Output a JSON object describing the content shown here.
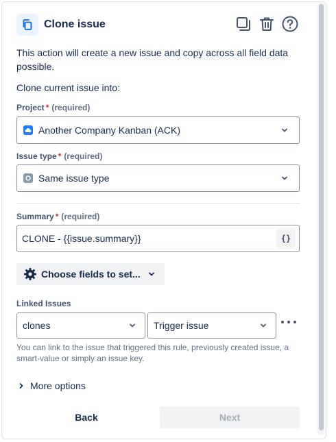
{
  "header": {
    "title": "Clone issue",
    "icon": "copy-icon",
    "actions": [
      "duplicate-icon",
      "delete-icon",
      "help-icon"
    ]
  },
  "description": "This action will create a new issue and copy across all field data possible.",
  "clone_into": "Clone current issue into:",
  "project": {
    "label": "Project",
    "required_marker": "*",
    "required_text": "(required)",
    "value": "Another Company Kanban (ACK)",
    "icon": "cloud-project-icon"
  },
  "issue_type": {
    "label": "Issue type",
    "required_marker": "*",
    "required_text": "(required)",
    "value": "Same issue type",
    "icon": "issue-type-icon"
  },
  "summary": {
    "label": "Summary",
    "required_marker": "*",
    "required_text": "(required)",
    "value": "CLONE - {{issue.summary}}",
    "smart_value_button": "{}"
  },
  "choose_fields": {
    "label": "Choose fields to set...",
    "icon": "gear-icon"
  },
  "linked_issues": {
    "label": "Linked Issues",
    "link_type": "clones",
    "target": "Trigger issue",
    "helper": "You can link to the issue that triggered this rule, previously created issue, a smart-value or simply an issue key."
  },
  "more_options": "More options",
  "footer": {
    "back": "Back",
    "next": "Next"
  },
  "colors": {
    "accent": "#0c66e4",
    "required": "#c9372c",
    "text": "#172b4d",
    "subtle": "#626f86"
  }
}
